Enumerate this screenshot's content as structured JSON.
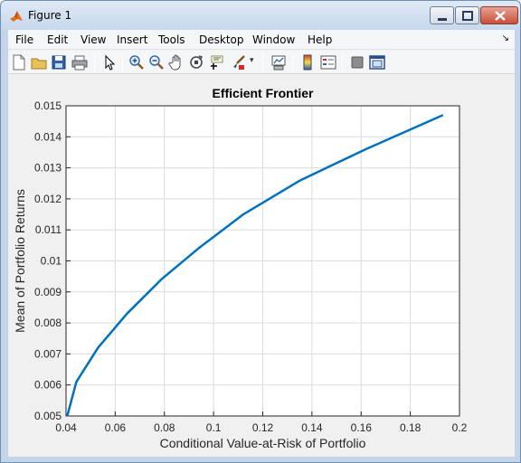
{
  "window": {
    "title": "Figure 1"
  },
  "menu": {
    "items": [
      "File",
      "Edit",
      "View",
      "Insert",
      "Tools",
      "Desktop",
      "Window",
      "Help"
    ]
  },
  "toolbar": {
    "icons": [
      "new-figure-icon",
      "open-file-icon",
      "save-icon",
      "print-icon",
      "pointer-icon",
      "zoom-in-icon",
      "zoom-out-icon",
      "pan-icon",
      "rotate-3d-icon",
      "data-cursor-icon",
      "brush-icon",
      "link-plot-icon",
      "colorbar-icon",
      "legend-icon",
      "hide-plot-tools-icon",
      "show-plot-tools-icon"
    ]
  },
  "colors": {
    "line": "#0072bd",
    "grid": "#dcdcdc",
    "axes_bg": "#ffffff",
    "figure_bg": "#f0f0f0"
  },
  "chart_data": {
    "type": "line",
    "title": "Efficient Frontier",
    "xlabel": "Conditional Value-at-Risk of Portfolio",
    "ylabel": "Mean of Portfolio Returns",
    "xlim": [
      0.04,
      0.2
    ],
    "ylim": [
      0.005,
      0.015
    ],
    "xticks": [
      "0.04",
      "0.06",
      "0.08",
      "0.1",
      "0.12",
      "0.14",
      "0.16",
      "0.18",
      "0.2"
    ],
    "yticks": [
      "0.005",
      "0.006",
      "0.007",
      "0.008",
      "0.009",
      "0.01",
      "0.011",
      "0.012",
      "0.013",
      "0.014",
      "0.015"
    ],
    "grid": true,
    "series": [
      {
        "x": [
          0.0405,
          0.0442,
          0.053,
          0.0648,
          0.0787,
          0.0938,
          0.1121,
          0.1353,
          0.1619,
          0.1933
        ],
        "y": [
          0.005,
          0.0061,
          0.0072,
          0.0083,
          0.0094,
          0.0104,
          0.0115,
          0.0126,
          0.0136,
          0.0147
        ]
      }
    ]
  }
}
